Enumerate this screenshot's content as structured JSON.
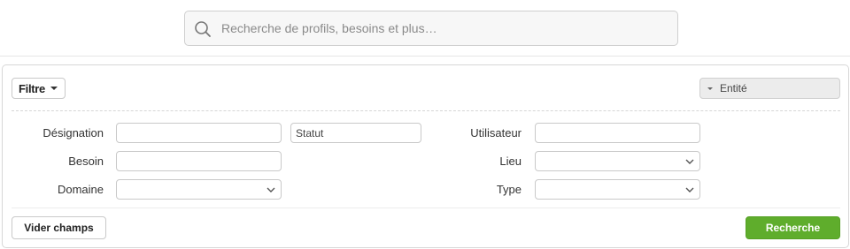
{
  "search": {
    "placeholder": "Recherche de profils, besoins et plus…",
    "icon": "search-icon"
  },
  "filter_panel": {
    "filter_button_label": "Filtre",
    "entity_dropdown_label": "Entité",
    "fields": {
      "designation_label": "Désignation",
      "designation_value": "",
      "statut_value": "Statut",
      "besoin_label": "Besoin",
      "besoin_value": "",
      "domaine_label": "Domaine",
      "domaine_value": "",
      "utilisateur_label": "Utilisateur",
      "utilisateur_value": "",
      "lieu_label": "Lieu",
      "lieu_value": "",
      "type_label": "Type",
      "type_value": ""
    },
    "clear_button_label": "Vider champs",
    "search_button_label": "Recherche"
  },
  "colors": {
    "primary_green": "#5fad2c",
    "border": "#c9c9c9",
    "search_bg": "#f7f7f7"
  }
}
